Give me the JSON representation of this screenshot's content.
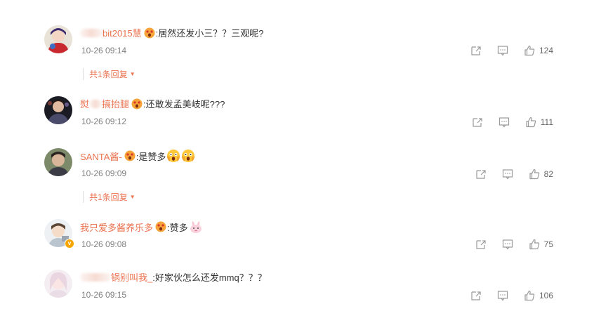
{
  "comments": [
    {
      "username": "bit2015慧",
      "text": ":居然还发小三？？三观呢?",
      "time": "10-26 09:14",
      "likes": "124",
      "reply_label": "共1条回复"
    },
    {
      "username": "搞抬腿",
      "text": ":还敢发孟美岐呢???",
      "time": "10-26 09:12",
      "likes": "111"
    },
    {
      "username": "SANTA酱-",
      "text": ":是赞多",
      "time": "10-26 09:09",
      "likes": "82",
      "reply_label": "共1条回复"
    },
    {
      "username": "我只爱多酱养乐多",
      "text": ":赞多",
      "time": "10-26 09:08",
      "likes": "75",
      "verified_badge": "v"
    },
    {
      "username": "锅别叫我_",
      "text": ":好家伙怎么还发mmq？？？",
      "time": "10-26 09:15",
      "likes": "106"
    }
  ],
  "colors": {
    "username": "#eb7350",
    "text": "#333333",
    "meta": "#808080",
    "badge": "#f7a600"
  },
  "icons": {
    "share": "share-icon",
    "comment": "comment-icon",
    "like": "thumbs-up-icon",
    "emoji_scream": "scream-emoji",
    "emoji_bunny": "bunny-emoji"
  }
}
